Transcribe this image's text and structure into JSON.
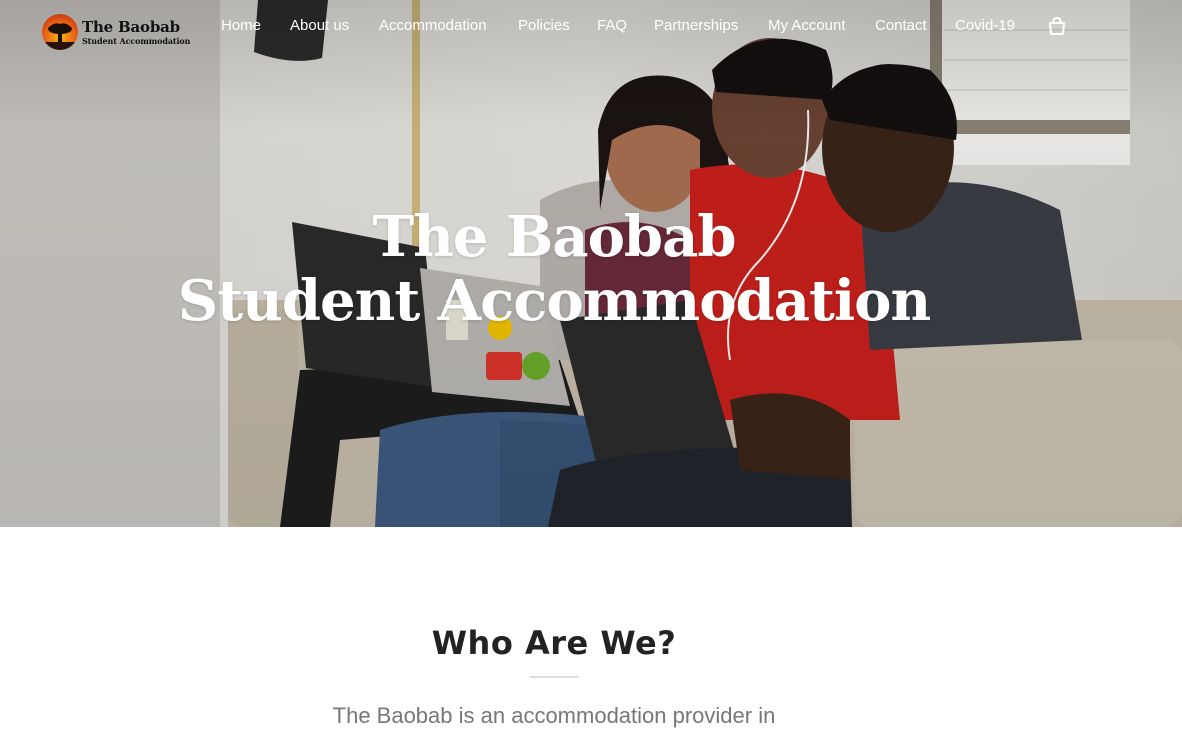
{
  "brand": {
    "title": "The Baobab",
    "subtitle": "Student Accommodation",
    "logo_icon": "baobab-tree-sunset-icon"
  },
  "nav": {
    "items": [
      {
        "label": "Home"
      },
      {
        "label": "About us"
      },
      {
        "label": "Accommodation"
      },
      {
        "label": "Policies"
      },
      {
        "label": "FAQ"
      },
      {
        "label": "Partnerships"
      },
      {
        "label": "My Account"
      },
      {
        "label": "Contact"
      },
      {
        "label": "Covid-19"
      }
    ],
    "cart_icon": "shopping-bag-icon"
  },
  "hero": {
    "title_line1": "The Baobab",
    "title_line2": "Student Accommodation"
  },
  "about": {
    "heading": "Who Are We?",
    "intro": "The Baobab is an accommodation provider in"
  },
  "colors": {
    "hero_text": "#ffffff",
    "heading_text": "#222222",
    "body_text": "#777777",
    "shirt_red": "#c8201c"
  }
}
